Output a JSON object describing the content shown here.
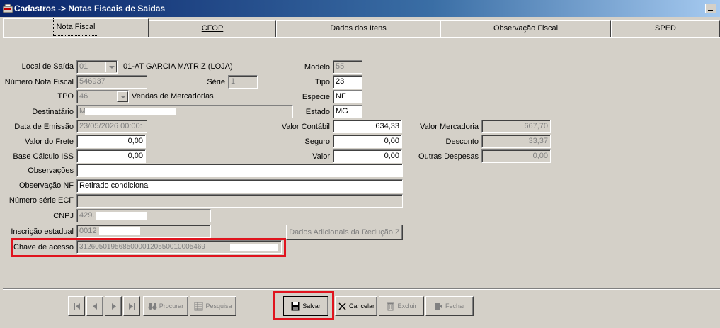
{
  "window": {
    "title": "Cadastros -> Notas Fiscais de Saidas"
  },
  "tabs": [
    {
      "label": "Nota Fiscal"
    },
    {
      "label": "CFOP"
    },
    {
      "label": "Dados dos Itens"
    },
    {
      "label": "Observação Fiscal"
    },
    {
      "label": "SPED"
    }
  ],
  "form": {
    "local_saida": {
      "label": "Local de Saída",
      "value": "01",
      "description": "01-AT GARCIA MATRIZ (LOJA)"
    },
    "modelo": {
      "label": "Modelo",
      "value": "55"
    },
    "numero_nf": {
      "label": "Número Nota Fiscal",
      "value": "546937"
    },
    "serie": {
      "label": "Série",
      "value": "1"
    },
    "tipo": {
      "label": "Tipo",
      "value": "23"
    },
    "tpo": {
      "label": "TPO",
      "value": "46",
      "description": "Vendas de Mercadorias"
    },
    "especie": {
      "label": "Especie",
      "value": "NF"
    },
    "destinatario": {
      "label": "Destinatário",
      "value": "M"
    },
    "estado": {
      "label": "Estado",
      "value": "MG"
    },
    "data_emissao": {
      "label": "Data de Emissão",
      "value": "23/05/2026 00:00:"
    },
    "valor_contabil": {
      "label": "Valor Contábil",
      "value": "634,33"
    },
    "valor_mercadoria": {
      "label": "Valor Mercadoria",
      "value": "667,70"
    },
    "valor_frete": {
      "label": "Valor do Frete",
      "value": "0,00"
    },
    "seguro": {
      "label": "Seguro",
      "value": "0,00"
    },
    "desconto": {
      "label": "Desconto",
      "value": "33,37"
    },
    "base_iss": {
      "label": "Base Cálculo ISS",
      "value": "0,00"
    },
    "valor": {
      "label": "Valor",
      "value": "0,00"
    },
    "outras_despesas": {
      "label": "Outras Despesas",
      "value": "0,00"
    },
    "observacoes": {
      "label": "Observações",
      "value": ""
    },
    "observacao_nf": {
      "label": "Observação NF",
      "value": "Retirado  condicional"
    },
    "numero_serie_ecf": {
      "label": "Número série ECF",
      "value": ""
    },
    "cnpj": {
      "label": "CNPJ",
      "value": "429."
    },
    "inscricao_estadual": {
      "label": "Inscrição estadual",
      "value": "0012"
    },
    "chave_acesso": {
      "label": "Chave de acesso",
      "value": "31260501956850000120550010005469"
    },
    "dados_adicionais_label": "Dados Adicionais da Redução Z"
  },
  "toolbar": {
    "procurar": "Procurar",
    "pesquisa": "Pesquisa",
    "salvar": "Salvar",
    "cancelar": "Cancelar",
    "excluir": "Excluir",
    "fechar": "Fechar"
  },
  "colors": {
    "highlight": "#e0141e",
    "titlebar": "#0a246a",
    "window": "#d4d0c8"
  }
}
